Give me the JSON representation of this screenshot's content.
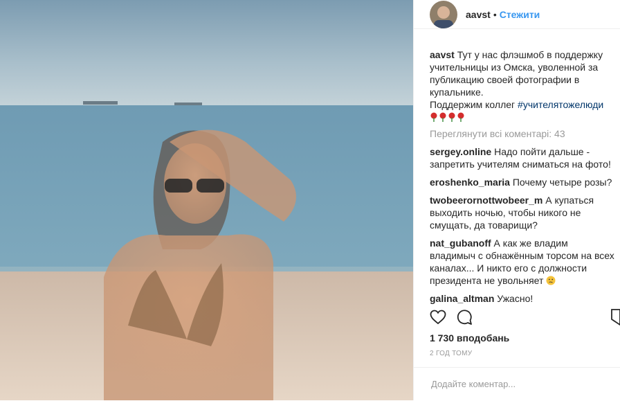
{
  "post": {
    "username": "aavst",
    "separator": "•",
    "follow_label": "Стежити",
    "caption_user": "aavst",
    "caption_text": "Тут у нас флэшмоб в поддержку учительницы из Омска, уволенной за публикацию своей фотографии в купальнике.",
    "caption_line2": "Поддержим коллег",
    "caption_hashtag": "#учителятожелюди",
    "rose_count": 4,
    "view_all": "Переглянути всі коментарі: 43",
    "comments": [
      {
        "user": "sergey.online",
        "text": "Надо пойти дальше - запретить учителям сниматься на фото!"
      },
      {
        "user": "eroshenko_maria",
        "text": "Почему четыре розы?"
      },
      {
        "user": "twobeerornottwobeer_m",
        "text": "А купаться выходить ночью, чтобы никого не смущать, да товарищи?"
      },
      {
        "user": "nat_gubanoff",
        "text": "А как же владим владимыч с обнажённым торсом на всех каналах... И никто его с должности президента не увольняет"
      },
      {
        "user": "galina_altman",
        "text": "Ужасно!"
      }
    ],
    "likes": "1 730 вподобань",
    "age": "2 ГОД ТОМУ",
    "add_comment_placeholder": "Додайте коментар..."
  },
  "icons": {
    "heart": "heart-icon",
    "comment": "comment-icon",
    "bookmark": "bookmark-icon",
    "rose": "rose-emoji-icon",
    "thinking": "thinking-emoji-icon"
  },
  "colors": {
    "link": "#3897f0",
    "hashtag": "#003569",
    "muted": "#999999",
    "text": "#262626"
  }
}
